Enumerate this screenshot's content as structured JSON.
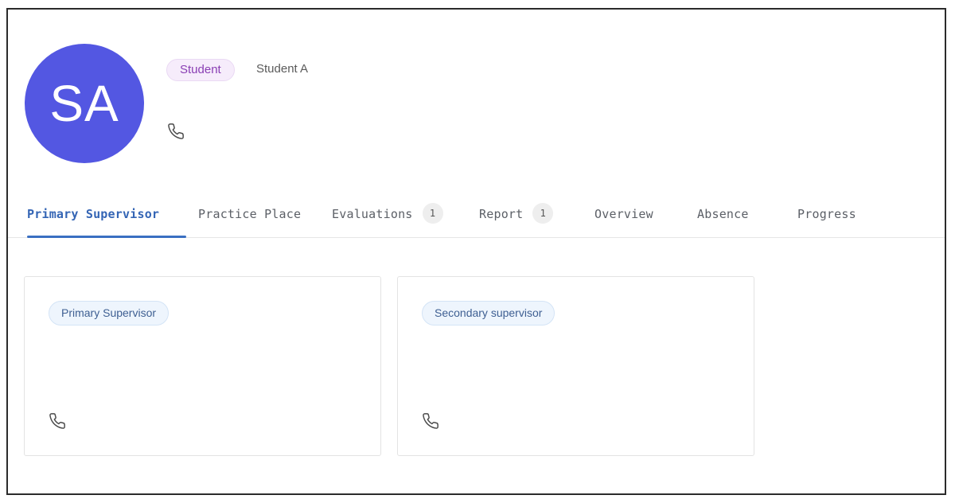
{
  "profile": {
    "initials": "SA",
    "role": "Student",
    "name": "Student A",
    "avatar_color": "#5357e2",
    "phone_icon": "phone-icon"
  },
  "tabs": [
    {
      "label": "Primary Supervisor",
      "active": true
    },
    {
      "label": "Practice Place"
    },
    {
      "label": "Evaluations",
      "count": "1"
    },
    {
      "label": "Report",
      "count": "1"
    },
    {
      "label": "Overview"
    },
    {
      "label": "Absence"
    },
    {
      "label": "Progress"
    }
  ],
  "cards": [
    {
      "badge": "Primary Supervisor",
      "icon": "phone-icon"
    },
    {
      "badge": "Secondary supervisor",
      "icon": "phone-icon"
    }
  ],
  "colors": {
    "accent": "#3465b5",
    "role_badge_text": "#8a3fb4",
    "role_badge_bg": "#f6ecfb",
    "card_badge_bg": "#eef5fd"
  }
}
